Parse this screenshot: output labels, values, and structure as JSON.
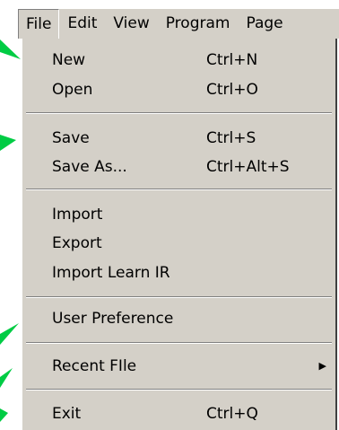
{
  "menubar": {
    "items": [
      {
        "label": "File"
      },
      {
        "label": "Edit"
      },
      {
        "label": "View"
      },
      {
        "label": "Program"
      },
      {
        "label": "Page"
      }
    ]
  },
  "file_menu": {
    "new": {
      "label": "New",
      "shortcut": "Ctrl+N"
    },
    "open": {
      "label": "Open",
      "shortcut": "Ctrl+O"
    },
    "save": {
      "label": "Save",
      "shortcut": "Ctrl+S"
    },
    "save_as": {
      "label": "Save As...",
      "shortcut": "Ctrl+Alt+S"
    },
    "import": {
      "label": "Import"
    },
    "export": {
      "label": "Export"
    },
    "import_learn_ir": {
      "label": "Import Learn IR"
    },
    "user_preference": {
      "label": "User Preference"
    },
    "recent_file": {
      "label": "Recent FIle",
      "submenu_icon": "submenu-arrow-icon"
    },
    "exit": {
      "label": "Exit",
      "shortcut": "Ctrl+Q"
    }
  },
  "colors": {
    "menu_background": "#d4d0c8",
    "callout_arrow": "#00cc44"
  }
}
